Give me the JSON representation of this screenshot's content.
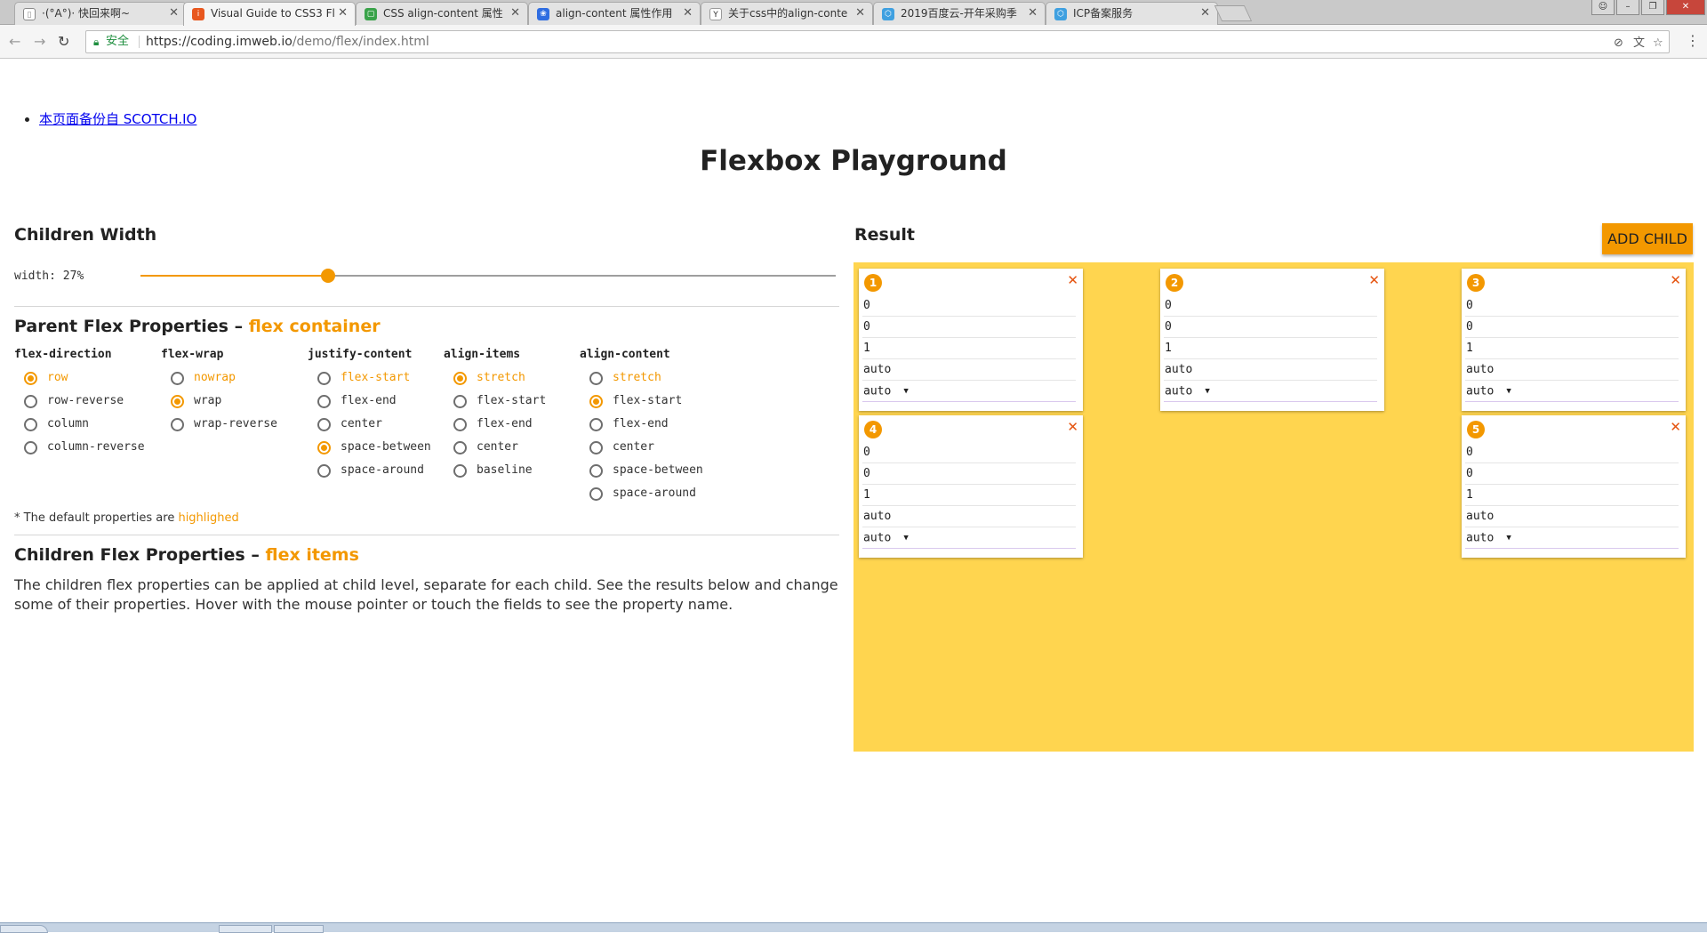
{
  "browser": {
    "tabs": [
      {
        "label": "·(°A°)· 快回来啊~",
        "active": false
      },
      {
        "label": "Visual Guide to CSS3 Fl",
        "active": true
      },
      {
        "label": "CSS align-content 属性",
        "active": false
      },
      {
        "label": "align-content 属性作用",
        "active": false
      },
      {
        "label": "关于css中的align-conte",
        "active": false
      },
      {
        "label": "2019百度云-开年采购季",
        "active": false
      },
      {
        "label": "ICP备案服务",
        "active": false
      }
    ],
    "address": {
      "secure_label": "安全",
      "url_host": "https://coding.imweb.io",
      "url_path": "/demo/flex/index.html"
    }
  },
  "page": {
    "backup_link": "本页面备份自 SCOTCH.IO",
    "title": "Flexbox Playground",
    "children_width": {
      "heading": "Children Width",
      "label": "width: 27%",
      "value_percent": 27
    },
    "parent": {
      "heading": "Parent Flex Properties –",
      "heading_accent": "flex container",
      "groups": [
        {
          "name": "flex-direction",
          "options": [
            "row",
            "row-reverse",
            "column",
            "column-reverse"
          ],
          "selected": "row",
          "default": "row"
        },
        {
          "name": "flex-wrap",
          "options": [
            "nowrap",
            "wrap",
            "wrap-reverse"
          ],
          "selected": "wrap",
          "default": "nowrap"
        },
        {
          "name": "justify-content",
          "options": [
            "flex-start",
            "flex-end",
            "center",
            "space-between",
            "space-around"
          ],
          "selected": "space-between",
          "default": "flex-start"
        },
        {
          "name": "align-items",
          "options": [
            "stretch",
            "flex-start",
            "flex-end",
            "center",
            "baseline"
          ],
          "selected": "stretch",
          "default": "stretch"
        },
        {
          "name": "align-content",
          "options": [
            "stretch",
            "flex-start",
            "flex-end",
            "center",
            "space-between",
            "space-around"
          ],
          "selected": "flex-start",
          "default": "stretch"
        }
      ],
      "note_prefix": "* The default properties are",
      "note_accent": "highlighed"
    },
    "children": {
      "heading": "Children Flex Properties –",
      "heading_accent": "flex items",
      "description": "The children flex properties can be applied at child level, separate for each child. See the results below and change some of their properties. Hover with the mouse pointer or touch the fields to see the property name."
    },
    "result": {
      "heading": "Result",
      "add_button": "ADD CHILD",
      "items": [
        {
          "number": "1",
          "order": "0",
          "grow": "0",
          "shrink": "1",
          "basis": "auto",
          "align_self": "auto"
        },
        {
          "number": "2",
          "order": "0",
          "grow": "0",
          "shrink": "1",
          "basis": "auto",
          "align_self": "auto"
        },
        {
          "number": "3",
          "order": "0",
          "grow": "0",
          "shrink": "1",
          "basis": "auto",
          "align_self": "auto"
        },
        {
          "number": "4",
          "order": "0",
          "grow": "0",
          "shrink": "1",
          "basis": "auto",
          "align_self": "auto"
        },
        {
          "number": "5",
          "order": "0",
          "grow": "0",
          "shrink": "1",
          "basis": "auto",
          "align_self": "auto"
        }
      ]
    }
  },
  "colors": {
    "accent": "#f39800",
    "result_bg": "#ffd54f",
    "remove": "#e55410"
  }
}
